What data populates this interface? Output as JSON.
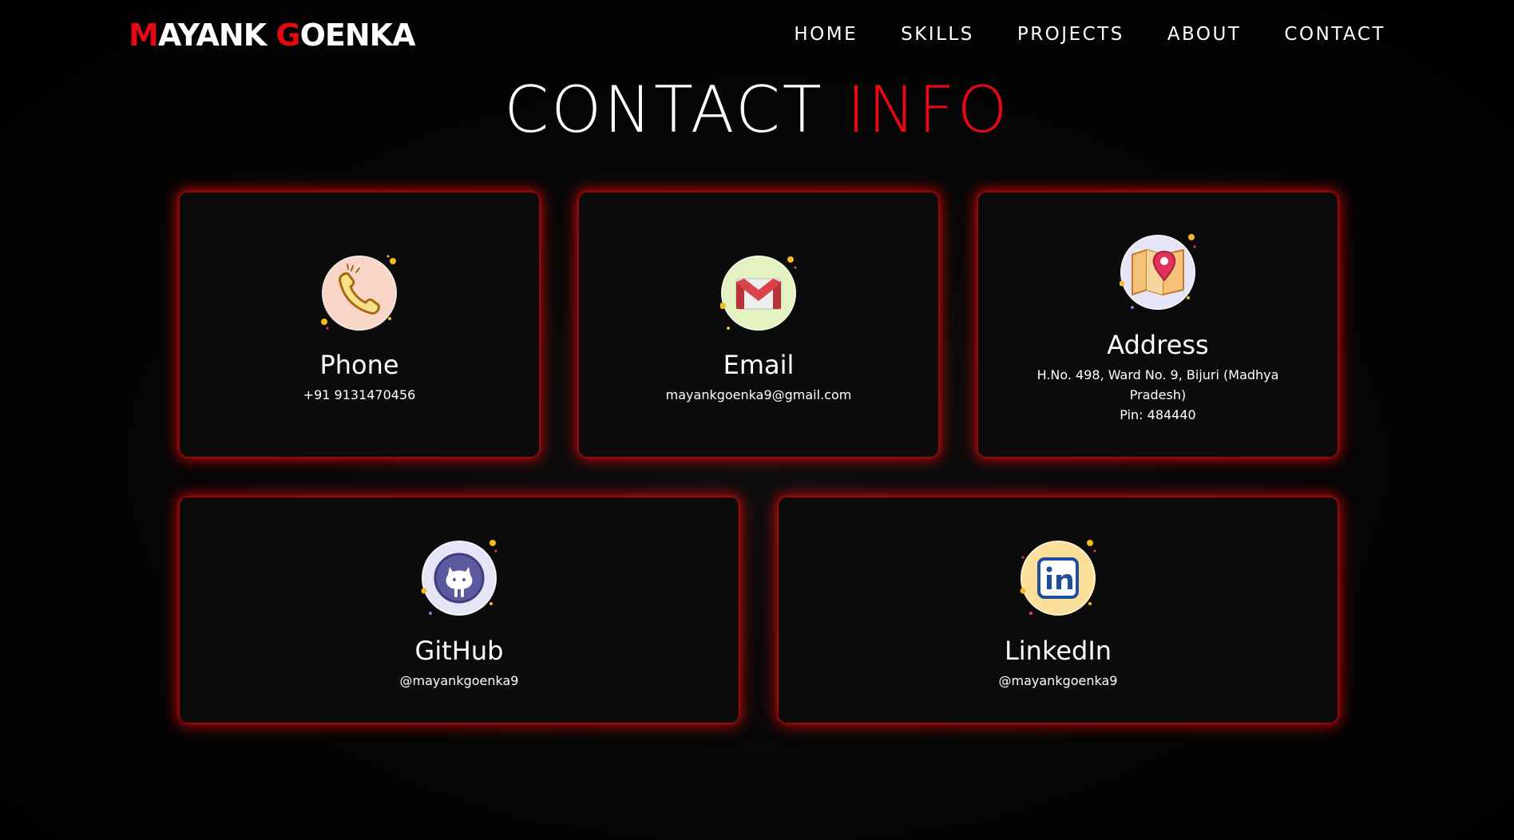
{
  "brand": {
    "first_initial": "M",
    "first_rest": "AYANK ",
    "last_initial": "G",
    "last_rest": "OENKA"
  },
  "nav": [
    "HOME",
    "SKILLS",
    "PROJECTS",
    "ABOUT",
    "CONTACT"
  ],
  "title": {
    "white": "CONTACT ",
    "red": "INFO"
  },
  "cards": {
    "phone": {
      "title": "Phone",
      "value": "+91 9131470456",
      "icon": "phone-icon"
    },
    "email": {
      "title": "Email",
      "value": "mayankgoenka9@gmail.com",
      "icon": "gmail-icon"
    },
    "address": {
      "title": "Address",
      "line1": "H.No. 498, Ward No. 9, Bijuri (Madhya Pradesh)",
      "line2": "Pin: 484440",
      "icon": "map-pin-icon"
    },
    "github": {
      "title": "GitHub",
      "value": "@mayankgoenka9",
      "icon": "github-icon"
    },
    "linkedin": {
      "title": "LinkedIn",
      "value": "@mayankgoenka9",
      "icon": "linkedin-icon"
    }
  },
  "colors": {
    "accent": "#e50914",
    "background": "#000000",
    "card": "#0b0b0b"
  }
}
